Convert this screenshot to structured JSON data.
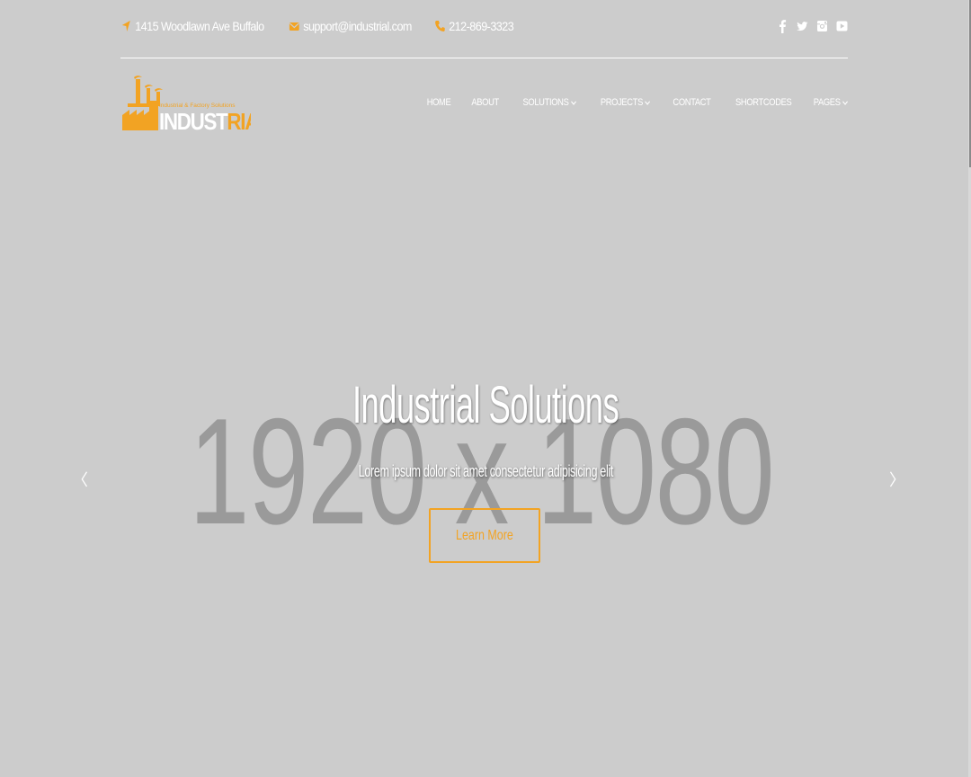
{
  "topbar": {
    "address": "1415 Woodlawn Ave Buffalo",
    "email": "support@industrial.com",
    "phone": "212-869-3323",
    "social": [
      "facebook-icon",
      "twitter-icon",
      "instagram-icon",
      "youtube-icon"
    ]
  },
  "logo": {
    "tagline": "Industrial & Factory Solutions",
    "name_main": "INDUST",
    "name_accent": "RIAL"
  },
  "nav": {
    "items": [
      {
        "label": "HOME",
        "has_dropdown": false
      },
      {
        "label": "ABOUT",
        "has_dropdown": false
      },
      {
        "label": "SOLUTIONS",
        "has_dropdown": true
      },
      {
        "label": "PROJECTS",
        "has_dropdown": true
      },
      {
        "label": "CONTACT",
        "has_dropdown": false
      },
      {
        "label": "SHORTCODES",
        "has_dropdown": false
      },
      {
        "label": "PAGES",
        "has_dropdown": true
      }
    ]
  },
  "hero": {
    "placeholder": "1920 x 1080",
    "title": "Industrial Solutions",
    "subtitle": "Lorem ipsum dolor sit amet consectetur adipisicing elit",
    "cta_label": "Learn More",
    "prev_arrow": "〈",
    "next_arrow": "〉"
  },
  "colors": {
    "accent": "#f2a323",
    "background": "#cccccc",
    "text": "#ffffff"
  }
}
